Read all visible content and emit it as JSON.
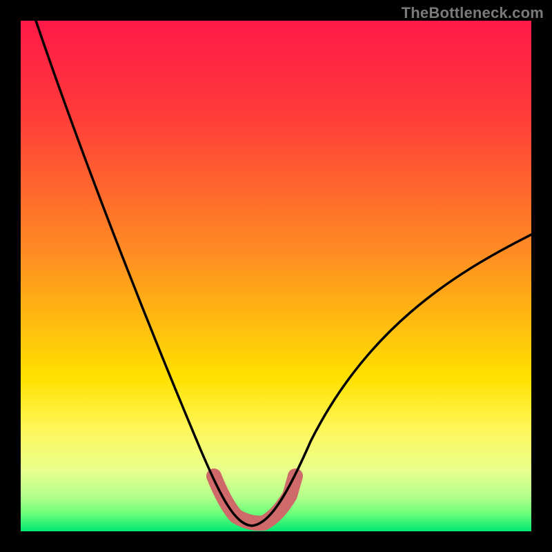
{
  "watermark": "TheBottleneck.com",
  "colors": {
    "border": "#000000",
    "curve": "#000000",
    "pink_band": "#cf6a6b",
    "grad_top": "#ff1948",
    "grad_orange": "#ff8b23",
    "grad_yellow": "#fff100",
    "grad_yellowgreen": "#e6ff3a",
    "grad_lime": "#9bff66",
    "grad_green": "#00e873"
  },
  "chart_data": {
    "type": "line",
    "title": "",
    "xlabel": "",
    "ylabel": "",
    "xlim": [
      0,
      100
    ],
    "ylim": [
      0,
      100
    ],
    "grid": false,
    "legend": false,
    "series": [
      {
        "name": "bottleneck-curve",
        "x": [
          3,
          6,
          10,
          14,
          18,
          22,
          26,
          30,
          34,
          38,
          40,
          42,
          44,
          46,
          48,
          50,
          54,
          60,
          66,
          72,
          80,
          90,
          100
        ],
        "y": [
          100,
          90,
          80,
          70,
          60,
          50,
          41,
          32,
          23,
          14,
          9,
          5,
          2,
          1,
          1,
          2,
          6,
          13,
          21,
          29,
          39,
          49,
          58
        ]
      },
      {
        "name": "minimum-band",
        "x": [
          39,
          41,
          43,
          45,
          47,
          49,
          51,
          53
        ],
        "y": [
          10,
          5,
          2,
          1,
          1,
          2,
          5,
          10
        ]
      }
    ],
    "annotations": [
      {
        "text": "TheBottleneck.com",
        "pos": "top-right"
      }
    ]
  }
}
